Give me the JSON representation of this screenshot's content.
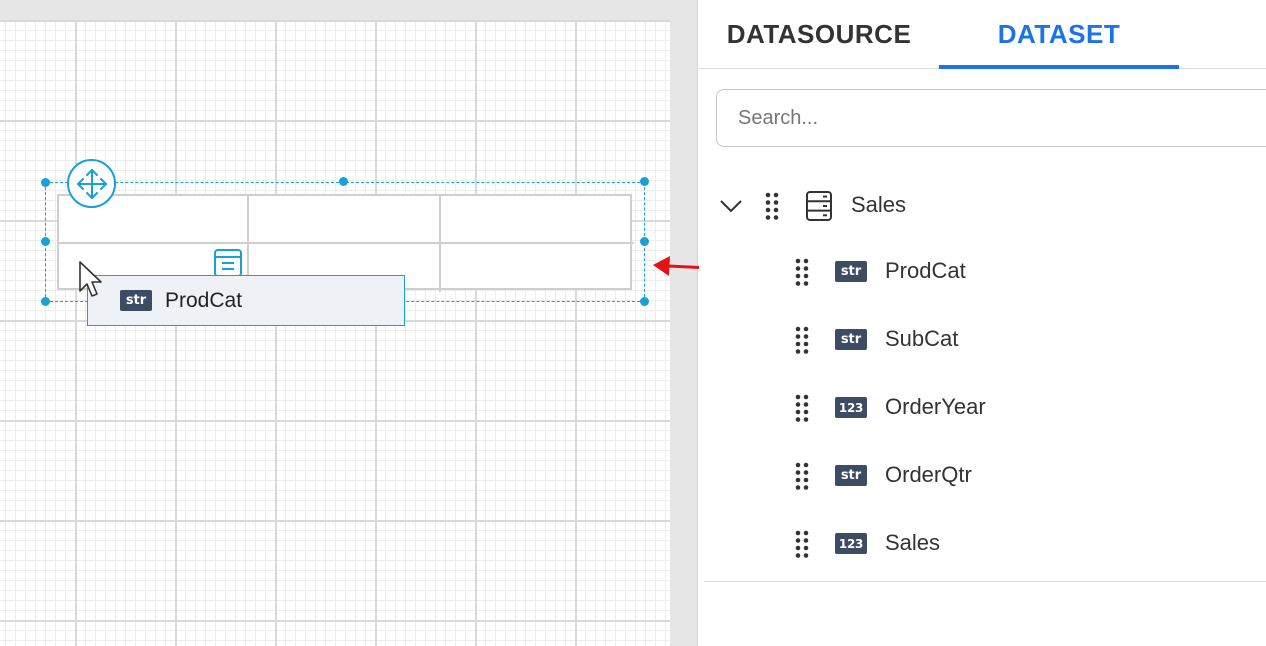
{
  "panel": {
    "tabs": [
      {
        "label": "DATASOURCE",
        "active": false
      },
      {
        "label": "DATASET",
        "active": true
      }
    ],
    "search": {
      "placeholder": "Search...",
      "value": ""
    },
    "dataset": {
      "name": "Sales",
      "icon": "database-icon",
      "expanded": true,
      "fields": [
        {
          "name": "ProdCat",
          "type": "str"
        },
        {
          "name": "SubCat",
          "type": "str"
        },
        {
          "name": "OrderYear",
          "type": "123"
        },
        {
          "name": "OrderQtr",
          "type": "str"
        },
        {
          "name": "Sales",
          "type": "123"
        }
      ]
    }
  },
  "canvas": {
    "drag_tooltip": {
      "type": "str",
      "label": "ProdCat"
    }
  },
  "colors": {
    "accent": "#1a73e8",
    "selection": "#1a9fd6",
    "badge": "#3d4b63",
    "arrow": "#e31313"
  }
}
